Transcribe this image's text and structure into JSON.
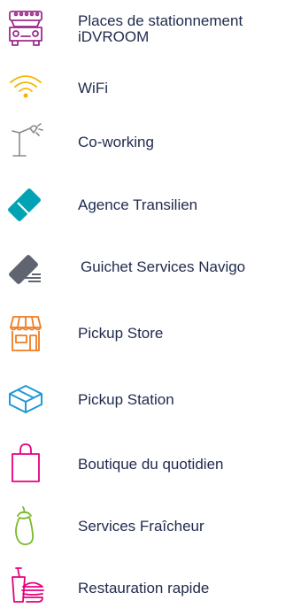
{
  "services": {
    "items": [
      {
        "label_line1": "Places de stationnement",
        "label_line2": "iDVROOM",
        "icon": "car-icon",
        "color": "#9b2d8c"
      },
      {
        "label": "WiFi",
        "icon": "wifi-icon",
        "color": "#f6b400"
      },
      {
        "label": "Co-working",
        "icon": "desk-lamp-icon",
        "color": "#8a8a8a"
      },
      {
        "label": "Agence Transilien",
        "icon": "ticket-icon",
        "color": "#00a3b4"
      },
      {
        "label": "Guichet Services Navigo",
        "icon": "navigo-card-icon",
        "color": "#5f6470"
      },
      {
        "label": "Pickup Store",
        "icon": "shop-icon",
        "color": "#f07c22"
      },
      {
        "label": "Pickup Station",
        "icon": "parcel-box-icon",
        "color": "#1d9ad6"
      },
      {
        "label": "Boutique du quotidien",
        "icon": "shopping-bag-icon",
        "color": "#e6007e"
      },
      {
        "label": "Services Fraîcheur",
        "icon": "eggplant-icon",
        "color": "#7ab829"
      },
      {
        "label": "Restauration rapide",
        "icon": "fast-food-icon",
        "color": "#e6007e"
      }
    ]
  }
}
